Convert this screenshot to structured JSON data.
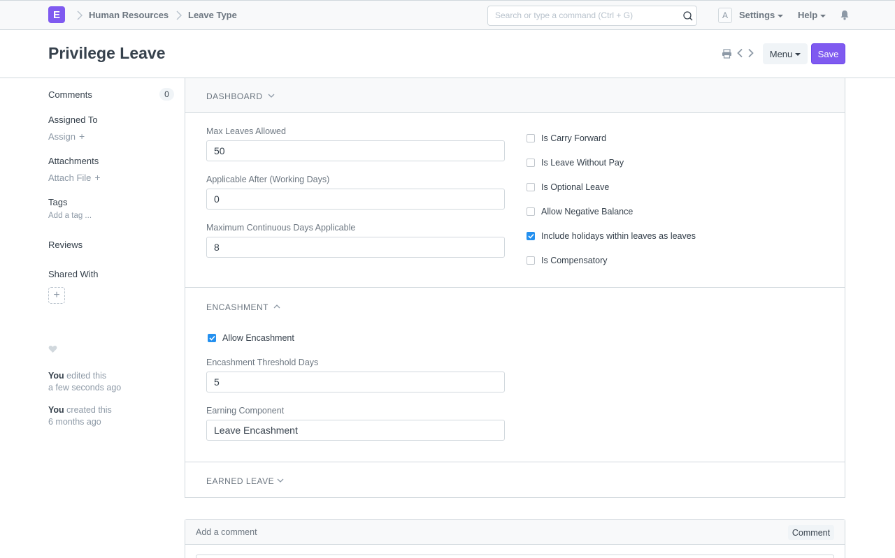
{
  "navbar": {
    "logo_letter": "E",
    "breadcrumbs": [
      "Human Resources",
      "Leave Type"
    ],
    "search_placeholder": "Search or type a command (Ctrl + G)",
    "avatar_letter": "A",
    "settings_label": "Settings",
    "help_label": "Help"
  },
  "header": {
    "title": "Privilege Leave",
    "menu_label": "Menu",
    "save_label": "Save"
  },
  "sidebar": {
    "comments_label": "Comments",
    "comments_count": "0",
    "assigned_to_label": "Assigned To",
    "assign_label": "Assign",
    "attachments_label": "Attachments",
    "attach_file_label": "Attach File",
    "tags_label": "Tags",
    "add_tag_label": "Add a tag ...",
    "reviews_label": "Reviews",
    "shared_with_label": "Shared With",
    "timeline": [
      {
        "actor": "You",
        "action": "edited this",
        "time": "a few seconds ago"
      },
      {
        "actor": "You",
        "action": "created this",
        "time": "6 months ago"
      }
    ]
  },
  "form": {
    "dashboard_title": "DASHBOARD",
    "fields": {
      "max_leaves": {
        "label": "Max Leaves Allowed",
        "value": "50"
      },
      "applicable_after": {
        "label": "Applicable After (Working Days)",
        "value": "0"
      },
      "max_continuous": {
        "label": "Maximum Continuous Days Applicable",
        "value": "8"
      }
    },
    "checks": [
      {
        "label": "Is Carry Forward",
        "checked": false
      },
      {
        "label": "Is Leave Without Pay",
        "checked": false
      },
      {
        "label": "Is Optional Leave",
        "checked": false
      },
      {
        "label": "Allow Negative Balance",
        "checked": false
      },
      {
        "label": "Include holidays within leaves as leaves",
        "checked": true
      },
      {
        "label": "Is Compensatory",
        "checked": false
      }
    ],
    "encashment_title": "ENCASHMENT",
    "allow_encashment": {
      "label": "Allow Encashment",
      "checked": true
    },
    "encashment_threshold": {
      "label": "Encashment Threshold Days",
      "value": "5"
    },
    "earning_component": {
      "label": "Earning Component",
      "value": "Leave Encashment"
    },
    "earned_leave_title": "EARNED LEAVE"
  },
  "comment": {
    "placeholder": "Add a comment",
    "button_label": "Comment"
  },
  "colors": {
    "accent": "#7f5af0",
    "checkbox": "#2490ef"
  }
}
